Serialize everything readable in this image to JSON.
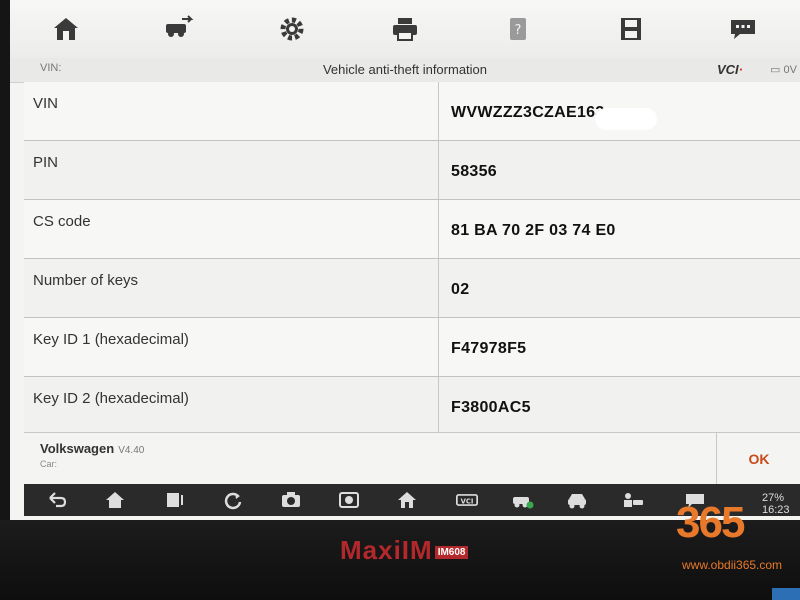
{
  "toolbar": {
    "icons": [
      "home-icon",
      "vehicle-swap-icon",
      "gear-icon",
      "printer-icon",
      "help-icon",
      "save-icon",
      "message-icon"
    ]
  },
  "header": {
    "vin_label": "VIN:",
    "title": "Vehicle anti-theft information",
    "vci": "VCI",
    "battery": "0V"
  },
  "table": {
    "rows": [
      {
        "label": "VIN",
        "value": "WVWZZZ3CZAE163"
      },
      {
        "label": "PIN",
        "value": "58356"
      },
      {
        "label": "CS code",
        "value": "81 BA 70 2F 03 74 E0"
      },
      {
        "label": "Number of keys",
        "value": "02"
      },
      {
        "label": "Key ID 1 (hexadecimal)",
        "value": "F47978F5"
      },
      {
        "label": "Key ID 2 (hexadecimal)",
        "value": "F3800AC5"
      }
    ]
  },
  "footer": {
    "make": "Volkswagen",
    "version": "V4.40",
    "sub": "Car:",
    "ok": "OK"
  },
  "navbar": {
    "status": "27%  16:23"
  },
  "device": {
    "brand": "MaxiIM",
    "model": "IM608"
  },
  "watermark": {
    "number": "365",
    "url": "www.obdii365.com"
  },
  "colors": {
    "accent": "#b3282b",
    "ok": "#c94a1a",
    "watermark": "#e8792a"
  }
}
